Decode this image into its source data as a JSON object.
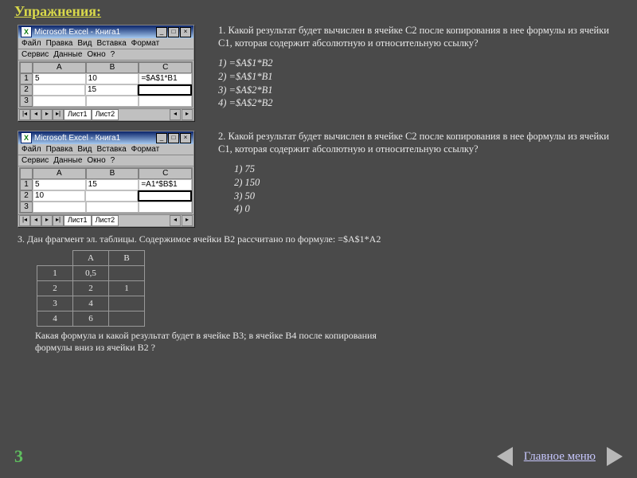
{
  "header": "Упражнения:",
  "excel_common": {
    "app_title": "Microsoft Excel - Книга1",
    "menu": [
      "Файл",
      "Правка",
      "Вид",
      "Вставка",
      "Формат"
    ],
    "menu2": [
      "Сервис",
      "Данные",
      "Окно",
      "?"
    ],
    "columns": [
      "A",
      "B",
      "C"
    ],
    "tabs": [
      "Лист1",
      "Лист2"
    ]
  },
  "q1": {
    "question": "1. Какой результат будет вычислен в ячейке С2 после копирования в нее формулы из ячейки С1, которая содержит абсолютную и относительную ссылку?",
    "answers": [
      "1)  =$A$1*B2",
      "2)  =$A$1*B1",
      "3)  =$A$2*B1",
      "4)  =$A$2*B2"
    ],
    "sheet_rows": [
      {
        "r": "1",
        "a": "5",
        "b": "10",
        "c": "=$A$1*B1"
      },
      {
        "r": "2",
        "a": "",
        "b": "15",
        "c": ""
      },
      {
        "r": "3",
        "a": "",
        "b": "",
        "c": ""
      }
    ]
  },
  "q2": {
    "question": "2. Какой результат будет вычислен в ячейке С2 после копирования в нее формулы из ячейки С1, которая содержит абсолютную и относительную ссылку?",
    "answers": [
      "1)  75",
      "2)  150",
      "3)  50",
      "4)  0"
    ],
    "sheet_rows": [
      {
        "r": "1",
        "a": "5",
        "b": "15",
        "c": "=A1*$B$1"
      },
      {
        "r": "2",
        "a": "10",
        "b": "",
        "c": ""
      },
      {
        "r": "3",
        "a": "",
        "b": "",
        "c": ""
      }
    ]
  },
  "q3": {
    "intro": "3. Дан фрагмент эл. таблицы. Содержимое ячейки В2 рассчитано по формуле: =$A$1*A2",
    "table": {
      "cols": [
        "",
        "A",
        "B"
      ],
      "rows": [
        [
          "1",
          "0,5",
          ""
        ],
        [
          "2",
          "2",
          "1"
        ],
        [
          "3",
          "4",
          ""
        ],
        [
          "4",
          "6",
          ""
        ]
      ]
    },
    "followup": "Какая формула и какой результат будет в ячейке В3; в ячейке В4 после копирования формулы вниз из ячейки В2 ?"
  },
  "page_number": "3",
  "main_menu_label": "Главное меню"
}
